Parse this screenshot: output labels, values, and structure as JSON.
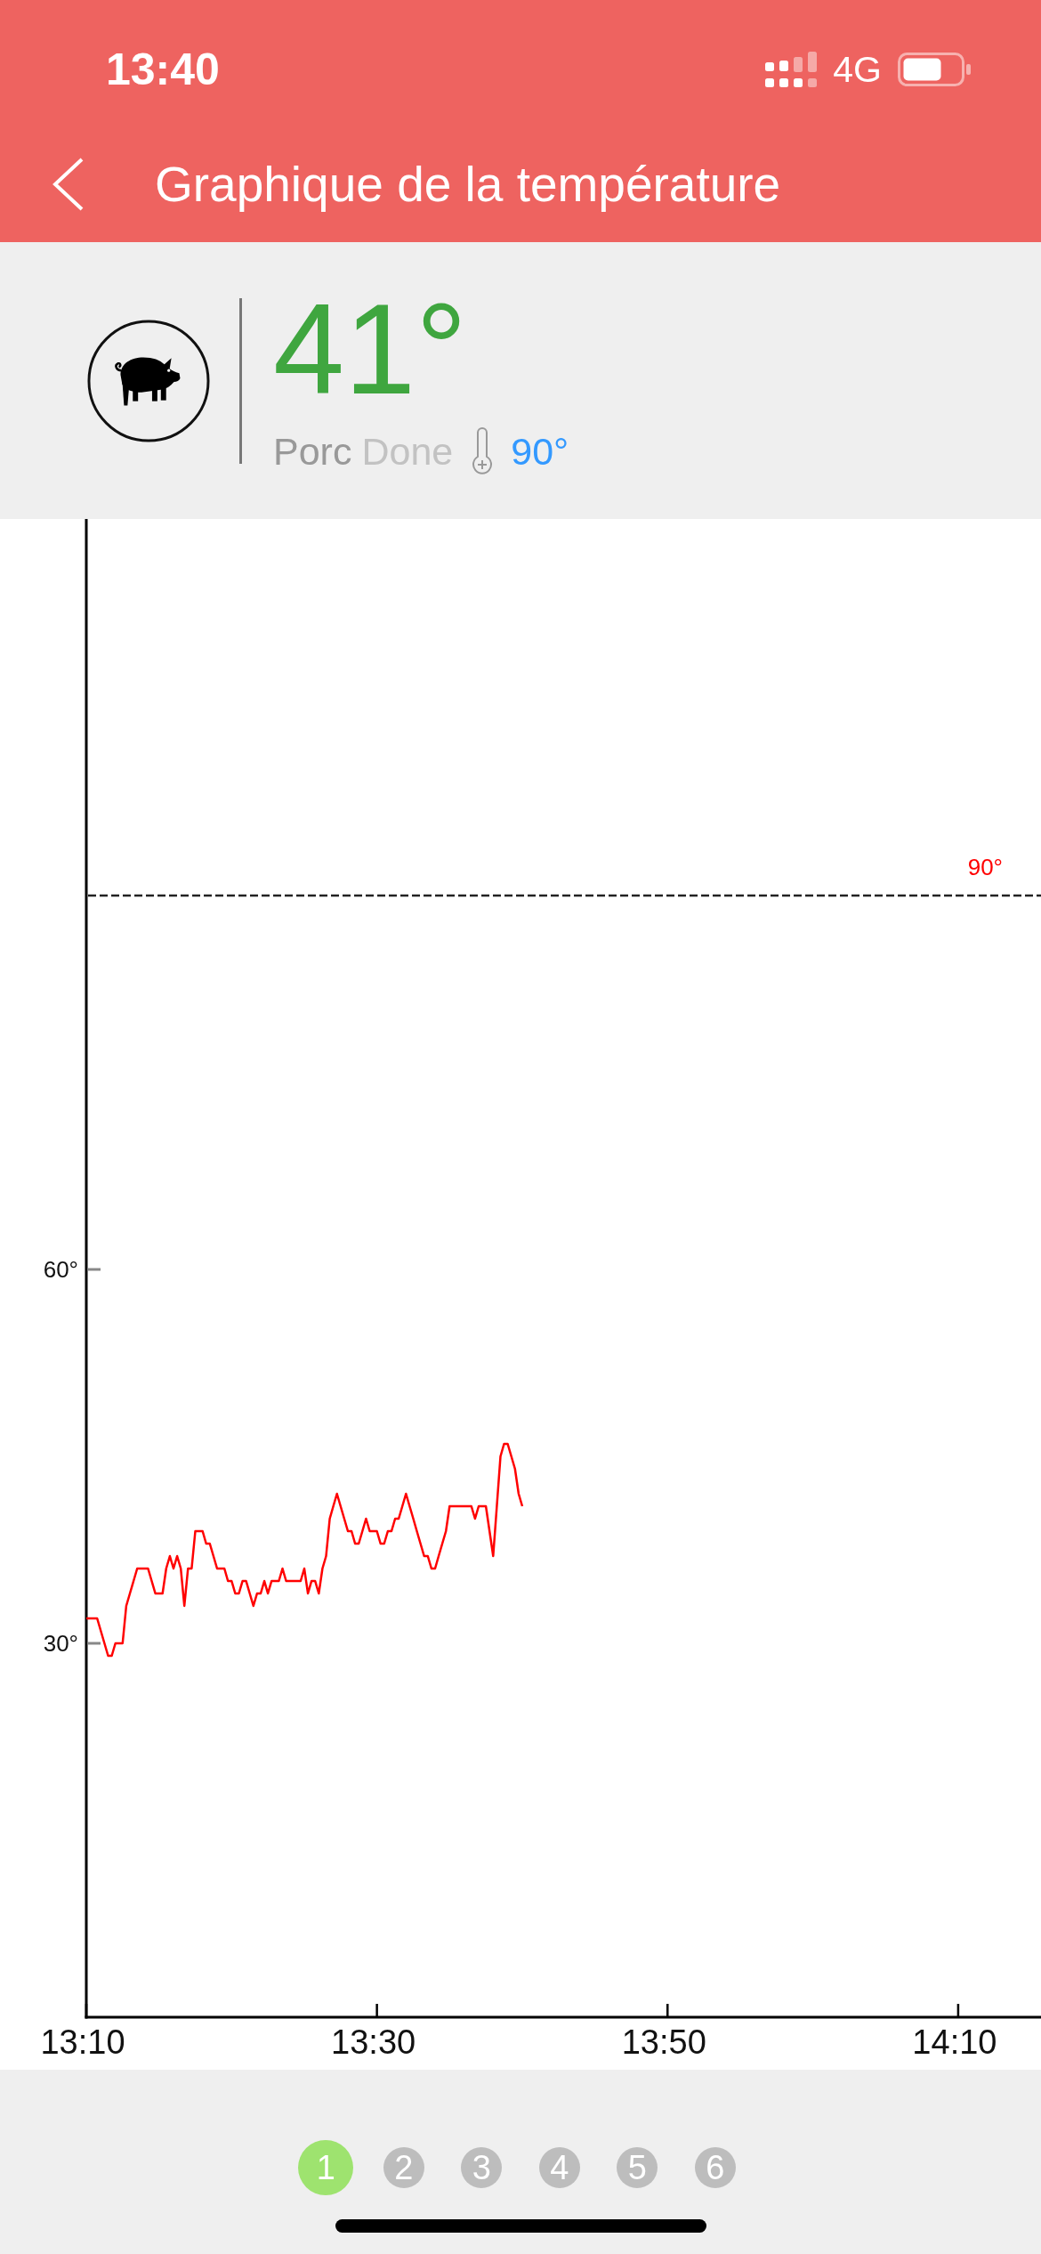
{
  "status_bar": {
    "time": "13:40",
    "network": "4G"
  },
  "nav_bar": {
    "title": "Graphique de la température"
  },
  "probe": {
    "temperature": "41°",
    "meat": "Porc",
    "doneness": "Done",
    "target": "90°"
  },
  "chart": {
    "chart_data": {
      "type": "line",
      "categories": [
        "13:10",
        null,
        null,
        null,
        null,
        null,
        null,
        null,
        null,
        null,
        null,
        null,
        null,
        null,
        null,
        null,
        null,
        null,
        null,
        null,
        null,
        null,
        null,
        null,
        null,
        null,
        null,
        null,
        null,
        null,
        null,
        null,
        null,
        null,
        null,
        null,
        null,
        null,
        null,
        null,
        null,
        null,
        null,
        null,
        null,
        null,
        null,
        null,
        null,
        null,
        null,
        null,
        null,
        null,
        null,
        null,
        null,
        null,
        null,
        null,
        null,
        null,
        null,
        null,
        null,
        null,
        null,
        null,
        null,
        null,
        null,
        null,
        null,
        null,
        null,
        null,
        null,
        null,
        null,
        null,
        "13:30",
        null,
        null,
        null,
        null,
        null,
        null,
        null,
        null,
        null,
        null,
        null,
        null,
        null,
        null,
        null,
        null,
        null,
        null,
        null,
        null,
        null,
        null,
        null,
        null,
        null,
        null,
        null,
        null,
        null,
        null,
        null,
        null,
        null,
        null,
        null,
        null,
        null,
        null,
        null,
        null,
        null,
        null,
        null,
        null,
        null,
        null,
        null,
        null,
        null,
        null,
        null,
        null,
        null,
        null,
        null,
        null,
        null,
        null,
        null,
        null,
        null,
        null,
        null,
        null,
        null,
        null,
        null,
        null,
        null,
        null,
        null,
        null,
        null,
        null,
        null,
        null,
        null,
        null,
        null,
        "13:50",
        null,
        null,
        null,
        null,
        null,
        null,
        null,
        null,
        null,
        null,
        null,
        null,
        null,
        null,
        null,
        null,
        null,
        null,
        null,
        null,
        null,
        null,
        null,
        null,
        null,
        null,
        null,
        null,
        null,
        null,
        null,
        null,
        null,
        null,
        null,
        null,
        null,
        null,
        null,
        null,
        null,
        null,
        null,
        null,
        null,
        null,
        null,
        null,
        null,
        null,
        null,
        null,
        null,
        null,
        null,
        null,
        null,
        null,
        null,
        null,
        null,
        null,
        null,
        null,
        null,
        null,
        null,
        null,
        null,
        null,
        null,
        null,
        null,
        null,
        null,
        null,
        null,
        null,
        null,
        "14:10",
        null,
        null,
        null,
        null,
        null,
        null,
        null,
        null,
        null,
        null,
        null,
        null,
        null,
        null,
        null,
        null,
        null,
        null,
        null,
        null,
        null,
        null
      ],
      "series": [
        {
          "color": "#ff0000",
          "values": [
            32,
            32,
            32,
            32,
            31,
            30,
            29,
            29,
            30,
            30,
            30,
            33,
            34,
            35,
            36,
            36,
            36,
            36,
            35,
            34,
            34,
            34,
            36,
            37,
            36,
            37,
            36,
            33,
            36,
            36,
            39,
            39,
            39,
            38,
            38,
            37,
            36,
            36,
            36,
            35,
            35,
            34,
            34,
            35,
            35,
            34,
            33,
            34,
            34,
            35,
            34,
            35,
            35,
            35,
            36,
            35,
            35,
            35,
            35,
            35,
            36,
            34,
            35,
            35,
            34,
            36,
            37,
            40,
            41,
            42,
            41,
            40,
            39,
            39,
            38,
            38,
            39,
            40,
            39,
            39,
            39,
            38,
            38,
            39,
            39,
            40,
            40,
            41,
            42,
            41,
            40,
            39,
            38,
            37,
            37,
            36,
            36,
            37,
            38,
            39,
            41,
            41,
            41,
            41,
            41,
            41,
            41,
            40,
            41,
            41,
            41,
            39,
            37,
            41,
            45,
            46,
            46,
            45,
            44,
            42,
            41,
            null,
            null,
            null,
            null,
            null,
            null,
            null,
            null,
            null,
            null,
            null,
            null,
            null,
            null,
            null,
            null,
            null,
            null,
            null,
            null,
            null,
            null,
            null,
            null,
            null,
            null,
            null,
            null,
            null,
            null,
            null,
            null,
            null,
            null,
            null,
            null,
            null,
            null,
            null,
            null,
            null,
            null,
            null,
            null,
            null,
            null,
            null,
            null,
            null,
            null,
            null,
            null,
            null,
            null,
            null,
            null,
            null,
            null,
            null,
            null,
            null,
            null,
            null,
            null,
            null,
            null,
            null,
            null,
            null,
            null,
            null,
            null,
            null,
            null,
            null,
            null,
            null,
            null,
            null,
            null,
            null,
            null,
            null,
            null,
            null,
            null,
            null,
            null,
            null,
            null,
            null,
            null,
            null,
            null,
            null,
            null,
            null,
            null,
            null,
            null,
            null,
            null,
            null,
            null,
            null,
            null,
            null,
            null,
            null,
            null,
            null,
            null,
            null,
            null,
            null,
            null,
            null,
            null,
            null,
            null,
            null,
            null,
            null,
            null,
            null,
            null,
            null,
            null,
            null,
            null,
            null,
            null,
            null,
            null,
            null,
            null,
            null,
            null,
            null,
            null,
            null,
            null
          ]
        }
      ],
      "ylim": [
        0,
        120
      ],
      "yticks": [
        {
          "value": 30,
          "label": "30°"
        },
        {
          "value": 60,
          "label": "60°"
        }
      ],
      "ref_lines": [
        {
          "axis": "y",
          "value": 90,
          "label": "90°"
        }
      ]
    }
  },
  "pages": [
    {
      "label": "1",
      "selected": true
    },
    {
      "label": "2",
      "selected": false
    },
    {
      "label": "3",
      "selected": false
    },
    {
      "label": "4",
      "selected": false
    },
    {
      "label": "5",
      "selected": false
    },
    {
      "label": "6",
      "selected": false
    }
  ]
}
